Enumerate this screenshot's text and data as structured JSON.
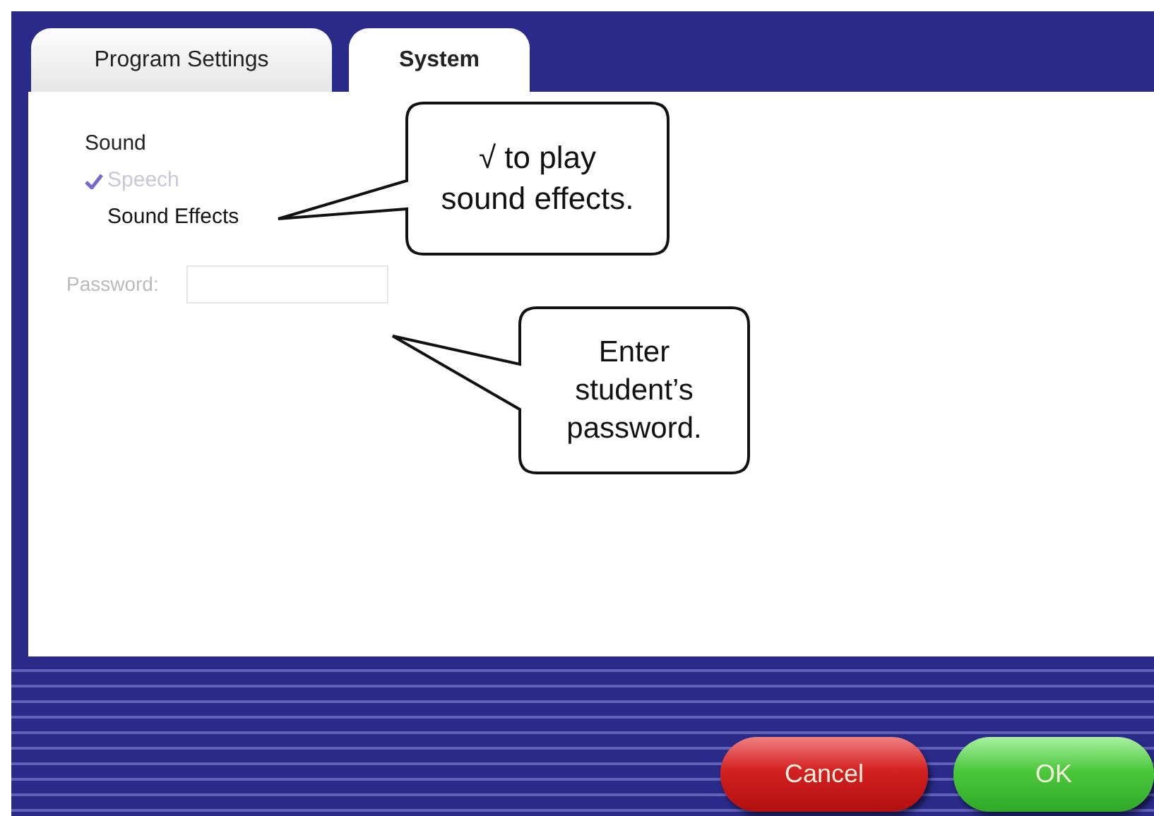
{
  "tabs": [
    {
      "label": "Program Settings",
      "selected": false
    },
    {
      "label": "System",
      "selected": true
    }
  ],
  "sound": {
    "heading": "Sound",
    "options": [
      {
        "label": "Speech",
        "checked": true,
        "disabled": true
      },
      {
        "label": "Sound Effects",
        "checked": false,
        "disabled": false
      }
    ]
  },
  "password": {
    "label": "Password:",
    "disabled": true
  },
  "callouts": [
    {
      "lines": [
        "√ to play",
        "sound effects."
      ]
    },
    {
      "lines": [
        "Enter",
        "student’s",
        "password."
      ]
    }
  ],
  "buttons": [
    {
      "label": "Cancel",
      "kind": "cancel"
    },
    {
      "label": "OK",
      "kind": "ok"
    }
  ]
}
